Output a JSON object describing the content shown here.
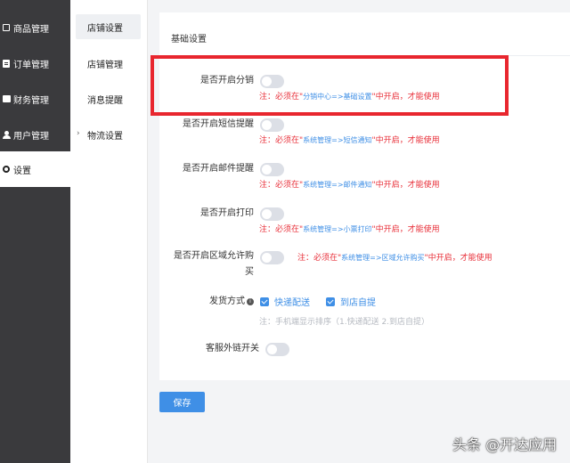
{
  "sidebar": {
    "items": [
      {
        "icon": "box-icon",
        "label": "商品管理"
      },
      {
        "icon": "order-icon",
        "label": "订单管理"
      },
      {
        "icon": "wallet-icon",
        "label": "财务管理"
      },
      {
        "icon": "user-icon",
        "label": "用户管理"
      },
      {
        "icon": "gear-icon",
        "label": "设置"
      }
    ],
    "active_index": 4
  },
  "submenu": {
    "items": [
      {
        "label": "店铺设置"
      },
      {
        "label": "店铺管理"
      },
      {
        "label": "消息提醒"
      },
      {
        "label": "物流设置",
        "has_chevron": true
      }
    ],
    "active_index": 0
  },
  "card": {
    "title": "基础设置",
    "settings": [
      {
        "label": "是否开启分销",
        "enabled": false,
        "note_red_1": "注：必须在\"",
        "note_blue": "分销中心=>基础设置",
        "note_red_2": "\"中开启，才能使用"
      },
      {
        "label": "是否开启短信提醒",
        "enabled": false,
        "note_red_1": "注：必须在\"",
        "note_blue": "系统管理=>短信通知",
        "note_red_2": "\"中开启，才能使用"
      },
      {
        "label": "是否开启邮件提醒",
        "enabled": false,
        "note_red_1": "注：必须在\"",
        "note_blue": "系统管理=>邮件通知",
        "note_red_2": "\"中开启，才能使用"
      },
      {
        "label": "是否开启打印",
        "enabled": false,
        "note_red_1": "注：必须在\"",
        "note_blue": "系统管理=>小票打印",
        "note_red_2": "\"中开启，才能使用"
      },
      {
        "label_line1": "是否开启区域允许购",
        "label_line2": "买",
        "enabled": false,
        "note_red_1": "注：必须在\"",
        "note_blue": "系统管理=>区域允许购买",
        "note_red_2": "\"中开启，才能使用"
      }
    ],
    "delivery": {
      "label": "发货方式",
      "info_icon": "i",
      "options": [
        {
          "label": "快递配送",
          "checked": true
        },
        {
          "label": "到店自提",
          "checked": true
        }
      ],
      "hint": "注：手机端显示排序（1.快递配送 2.到店自提）"
    },
    "service_link": {
      "label": "客服外链开关",
      "enabled": false
    }
  },
  "save_button": {
    "label": "保存"
  },
  "watermark": "头条 @开达应用",
  "colors": {
    "sidebar_bg": "#3a3a3d",
    "accent": "#3f8fe6",
    "note_red": "#e8303a",
    "highlight_red": "#e8262e"
  }
}
